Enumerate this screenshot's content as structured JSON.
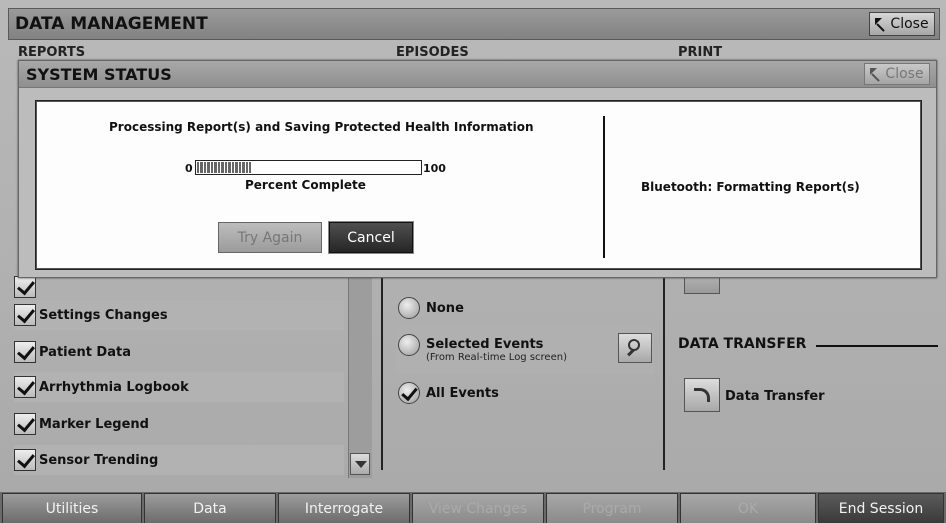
{
  "data_management": {
    "title": "DATA MANAGEMENT",
    "close_label": "Close",
    "sections": {
      "reports": "REPORTS",
      "episodes": "EPISODES",
      "print": "PRINT"
    },
    "report_items": [
      "Settings Changes",
      "Patient Data",
      "Arrhythmia Logbook",
      "Marker Legend",
      "Sensor Trending"
    ],
    "episode_options": {
      "none": "None",
      "selected": "Selected Events",
      "selected_sub": "(From Real-time Log screen)",
      "all": "All Events",
      "selected_value": "All Events"
    },
    "data_transfer": {
      "heading": "DATA TRANSFER",
      "button_label": "Data Transfer"
    }
  },
  "toolbar": {
    "utilities": "Utilities",
    "data": "Data",
    "interrogate": "Interrogate",
    "view_changes": "View Changes",
    "program": "Program",
    "ok": "OK",
    "end_session": "End Session"
  },
  "system_status": {
    "title": "SYSTEM STATUS",
    "close_label": "Close",
    "processing_text": "Processing Report(s) and Saving Protected Health Information",
    "progress": {
      "min_label": "0",
      "max_label": "100",
      "percent": 24,
      "caption": "Percent Complete"
    },
    "try_again_label": "Try Again",
    "cancel_label": "Cancel",
    "bluetooth_status": "Bluetooth: Formatting Report(s)"
  },
  "colors": {
    "accent_dark": "#262626",
    "disabled_text": "#777777"
  }
}
